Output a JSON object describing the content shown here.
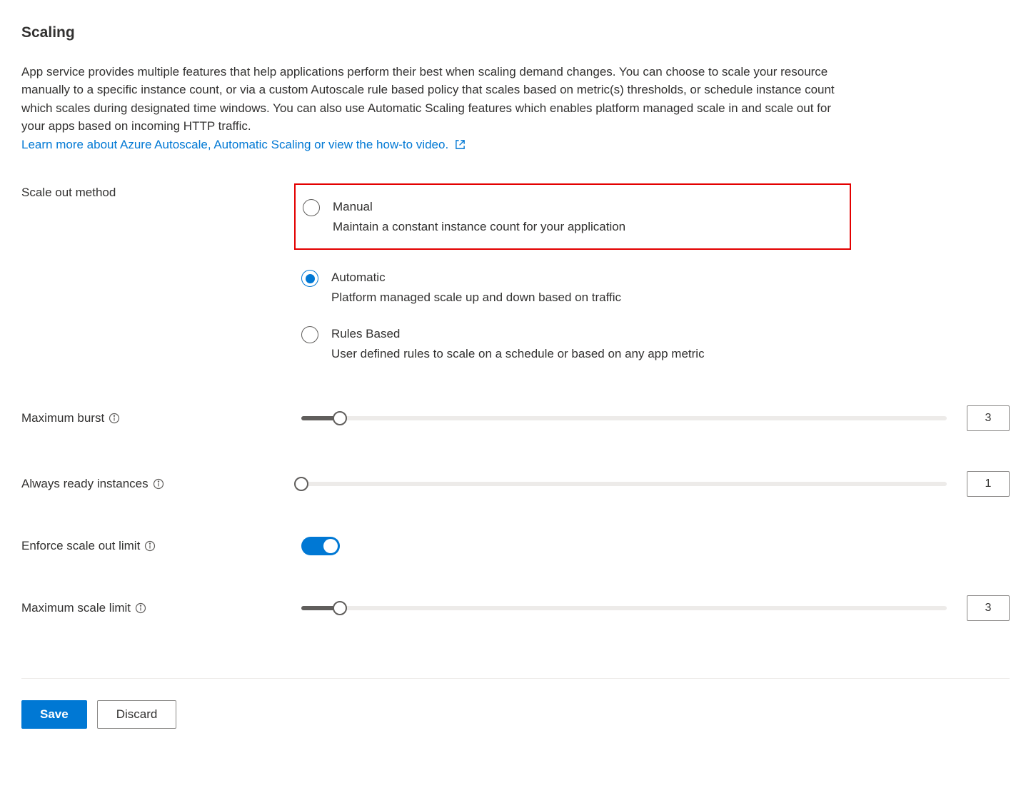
{
  "header": {
    "title": "Scaling",
    "description": "App service provides multiple features that help applications perform their best when scaling demand changes. You can choose to scale your resource manually to a specific instance count, or via a custom Autoscale rule based policy that scales based on metric(s) thresholds, or schedule instance count which scales during designated time windows. You can also use Automatic Scaling features which enables platform managed scale in and scale out for your apps based on incoming HTTP traffic.",
    "link_text": "Learn more about Azure Autoscale, Automatic Scaling or view the how-to video."
  },
  "form": {
    "scale_out_method": {
      "label": "Scale out method",
      "options": {
        "manual": {
          "title": "Manual",
          "desc": "Maintain a constant instance count for your application",
          "selected": false
        },
        "automatic": {
          "title": "Automatic",
          "desc": "Platform managed scale up and down based on traffic",
          "selected": true
        },
        "rules": {
          "title": "Rules Based",
          "desc": "User defined rules to scale on a schedule or based on any app metric",
          "selected": false
        }
      }
    },
    "maximum_burst": {
      "label": "Maximum burst",
      "value": "3"
    },
    "always_ready": {
      "label": "Always ready instances",
      "value": "1"
    },
    "enforce_limit": {
      "label": "Enforce scale out limit",
      "value": true
    },
    "max_scale_limit": {
      "label": "Maximum scale limit",
      "value": "3"
    }
  },
  "footer": {
    "save": "Save",
    "discard": "Discard"
  }
}
